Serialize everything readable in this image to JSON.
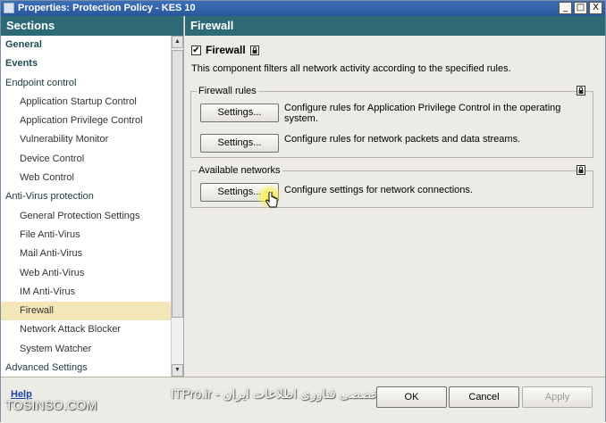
{
  "window": {
    "title": "Properties: Protection Policy - KES 10",
    "buttons": [
      "_",
      "□",
      "X"
    ]
  },
  "sections": {
    "header": "Sections",
    "items": [
      {
        "label": "General",
        "level": 0,
        "bold": true
      },
      {
        "label": "Events",
        "level": 0,
        "bold": true
      },
      {
        "label": "Endpoint control",
        "level": 0,
        "bold": false
      },
      {
        "label": "Application Startup Control",
        "level": 1
      },
      {
        "label": "Application Privilege Control",
        "level": 1
      },
      {
        "label": "Vulnerability Monitor",
        "level": 1
      },
      {
        "label": "Device Control",
        "level": 1
      },
      {
        "label": "Web Control",
        "level": 1
      },
      {
        "label": "Anti-Virus protection",
        "level": 0,
        "bold": false
      },
      {
        "label": "General Protection Settings",
        "level": 1
      },
      {
        "label": "File Anti-Virus",
        "level": 1
      },
      {
        "label": "Mail Anti-Virus",
        "level": 1
      },
      {
        "label": "Web Anti-Virus",
        "level": 1
      },
      {
        "label": "IM Anti-Virus",
        "level": 1
      },
      {
        "label": "Firewall",
        "level": 1,
        "selected": true
      },
      {
        "label": "Network Attack Blocker",
        "level": 1
      },
      {
        "label": "System Watcher",
        "level": 1
      },
      {
        "label": "Advanced Settings",
        "level": 0,
        "bold": false
      }
    ]
  },
  "firewall": {
    "header": "Firewall",
    "enable_label": "Firewall",
    "enabled": true,
    "description": "This component filters all network activity according to the specified rules.",
    "rules_group": {
      "title": "Firewall rules",
      "rows": [
        {
          "button": "Settings...",
          "text": "Configure rules for Application Privilege Control in the operating system."
        },
        {
          "button": "Settings...",
          "text": "Configure rules for network packets and data streams."
        }
      ]
    },
    "networks_group": {
      "title": "Available networks",
      "rows": [
        {
          "button": "Settings...",
          "text": "Configure settings for network connections."
        }
      ]
    }
  },
  "footer": {
    "help": "Help",
    "ok": "OK",
    "cancel": "Cancel",
    "apply": "Apply",
    "watermark": "TOSINSO.COM",
    "watermark_rtl": "ITPro.ir - انجمن تخصصی فناوری اطلاعات ایران"
  },
  "colors": {
    "header_bg": "#2e6a76",
    "selected_bg": "#f3e6b9",
    "title_bar": "#2a579b"
  }
}
